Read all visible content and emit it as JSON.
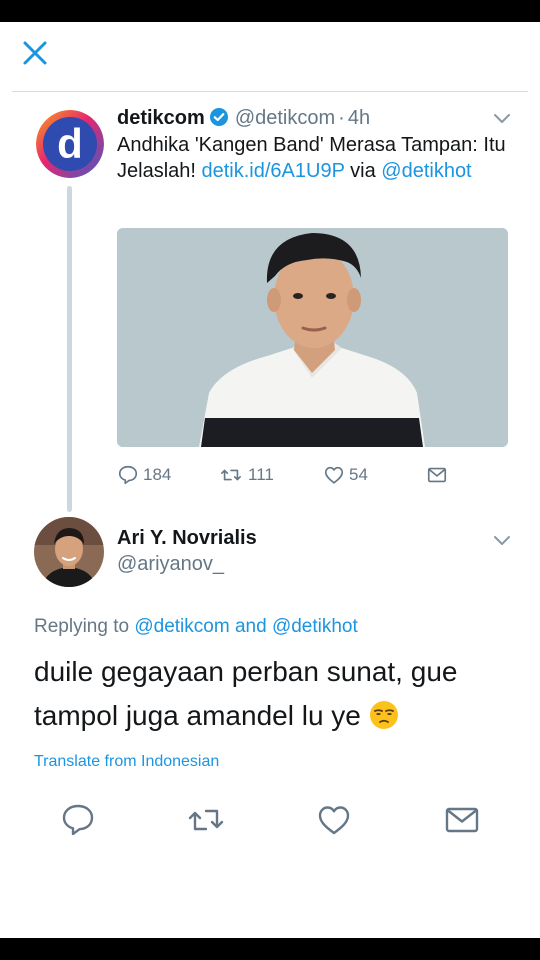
{
  "quoted_tweet": {
    "author_name": "detikcom",
    "handle": "@detikcom",
    "time_separator": "·",
    "time": "4h",
    "text_before": "Andhika 'Kangen Band' Merasa Tampan: Itu Jelaslah!",
    "link": "detik.id/6A1U9P",
    "via": "via",
    "mention": "@detikhot",
    "avatar_letter": "d",
    "stats": {
      "replies": "184",
      "retweets": "111",
      "likes": "54"
    }
  },
  "reply": {
    "author_name": "Ari Y. Novrialis",
    "handle": "@ariyanov_",
    "replying_prefix": "Replying to",
    "replying_user1": "@detikcom",
    "replying_and": "and",
    "replying_user2": "@detikhot",
    "text": "duile gegayaan perban sunat, gue tampol juga amandel lu ye",
    "translate_label": "Translate from Indonesian"
  },
  "icons": {
    "close": "close-icon",
    "verified": "verified-badge-icon",
    "reply": "reply-icon",
    "retweet": "retweet-icon",
    "like": "heart-icon",
    "dm": "envelope-icon",
    "caret": "chevron-down-icon",
    "emoji": "unamused-face-emoji"
  },
  "colors": {
    "accent": "#1b95e0",
    "secondary_text": "#657786",
    "primary_text": "#14171a",
    "divider": "#d5dbe0"
  }
}
